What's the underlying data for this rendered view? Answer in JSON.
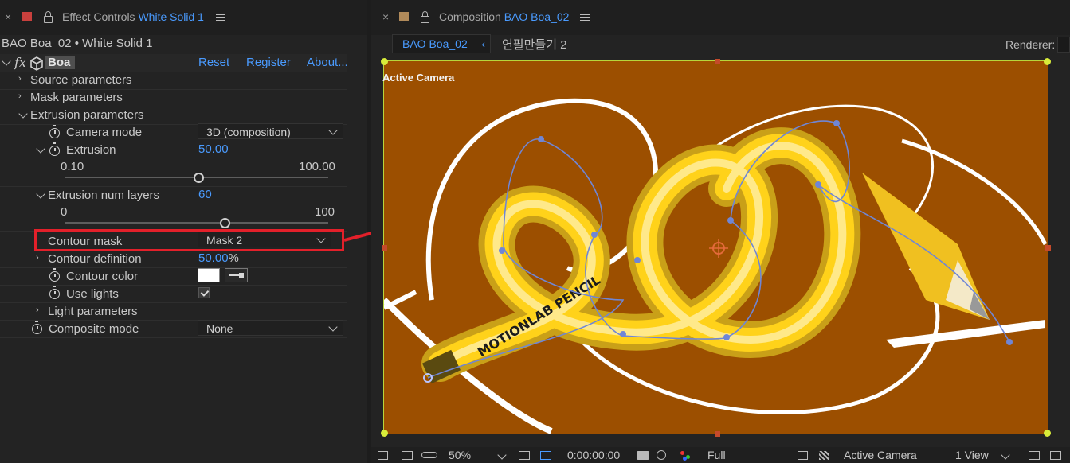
{
  "effect_controls": {
    "close": "×",
    "tab_prefix": "Effect Controls",
    "tab_layer": "White Solid 1",
    "breadcrumb": "BAO Boa_02 • White Solid 1",
    "effect_fx": "fx",
    "effect_name": "Boa",
    "reset_label": "Reset",
    "register_label": "Register",
    "about_label": "About...",
    "groups": {
      "source": "Source parameters",
      "mask": "Mask parameters",
      "extrusion": "Extrusion parameters",
      "light": "Light parameters"
    },
    "camera_mode": {
      "label": "Camera mode",
      "value": "3D (composition)"
    },
    "extrusion": {
      "label": "Extrusion",
      "value": "50.00",
      "min": "0.10",
      "max": "100.00",
      "fraction": 0.5
    },
    "extrusion_layers": {
      "label": "Extrusion num layers",
      "value": "60",
      "min": "0",
      "max": "100",
      "fraction": 0.6
    },
    "contour_mask": {
      "label": "Contour mask",
      "value": "Mask 2"
    },
    "contour_definition": {
      "label": "Contour definition",
      "value": "50.00",
      "unit": "%"
    },
    "contour_color": {
      "label": "Contour color",
      "swatch": "#ffffff"
    },
    "use_lights": {
      "label": "Use lights",
      "checked": true
    },
    "composite_mode": {
      "label": "Composite mode",
      "value": "None"
    },
    "highlight_color": "#e3202a",
    "label_color": "#c8403d"
  },
  "composition": {
    "close": "×",
    "tab_prefix": "Composition",
    "tab_comp": "BAO Boa_02",
    "subtab_active": "BAO Boa_02",
    "subtab_other": "연필만들기 2",
    "renderer_label": "Renderer:",
    "view_label": "Active Camera",
    "viewport_bg": "#9c4f00",
    "pencil_text": "MOTIONLAB PENCIL",
    "bottom": {
      "zoom": "50%",
      "timecode": "0:00:00:00",
      "resolution": "Full",
      "camera": "Active Camera",
      "views": "1 View"
    }
  },
  "colors": {
    "accent": "#4a9bff",
    "panel": "#232323",
    "label_swatch": "#b08a5a"
  }
}
